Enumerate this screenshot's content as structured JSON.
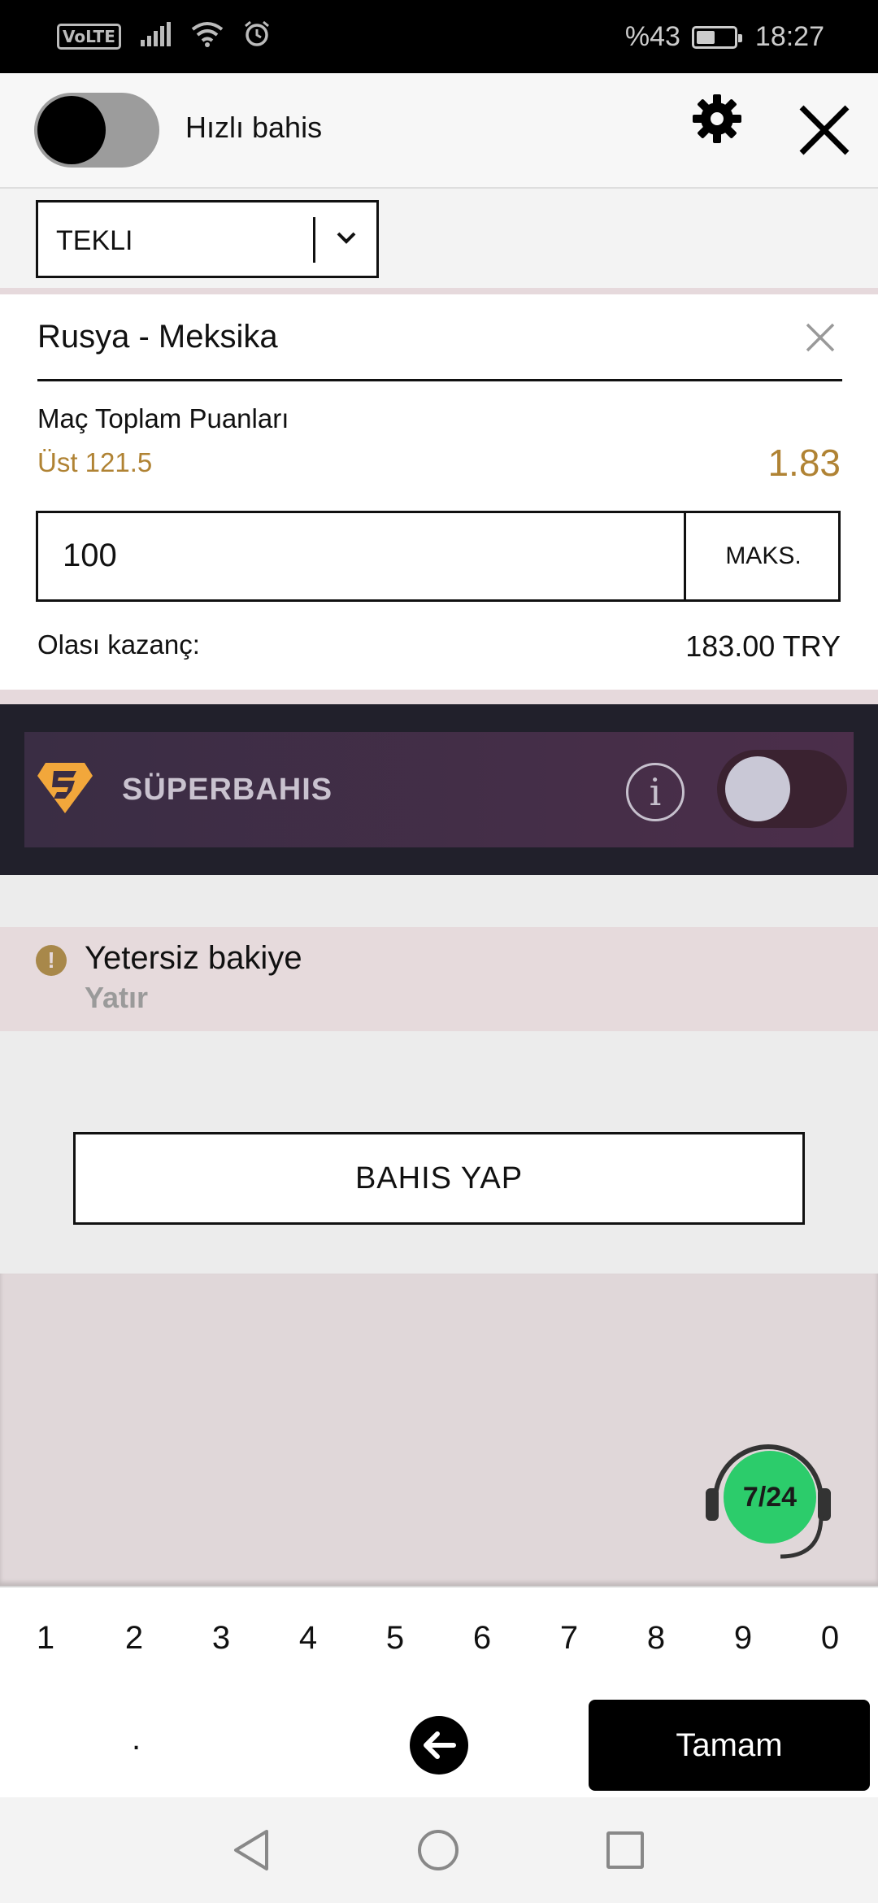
{
  "status_bar": {
    "volte": "VoLTE",
    "battery_text": "%43",
    "battery_level": 0.43,
    "time": "18:27"
  },
  "header": {
    "quick_bet_label": "Hızlı bahis",
    "quick_bet_enabled": false
  },
  "bet_type": {
    "selected": "TEKLI"
  },
  "bet": {
    "match": "Rusya - Meksika",
    "market": "Maç Toplam Puanları",
    "selection": "Üst 121.5",
    "odds": "1.83",
    "stake": "100",
    "max_label": "MAKS.",
    "potential_win_label": "Olası kazanç:",
    "potential_win_value": "183.00 TRY"
  },
  "superbahis": {
    "label": "SÜPERBAHIS",
    "enabled": false
  },
  "alert": {
    "title": "Yetersiz bakiye",
    "link": "Yatır"
  },
  "place_bet_label": "BAHIS YAP",
  "support_badge": "7/24",
  "keypad": {
    "digits": [
      "1",
      "2",
      "3",
      "4",
      "5",
      "6",
      "7",
      "8",
      "9",
      "0"
    ],
    "dot": ".",
    "done_label": "Tamam"
  },
  "colors": {
    "accent_gold": "#b08334",
    "support_green": "#2ccc6b",
    "superbahis_bg": "#21202b"
  }
}
